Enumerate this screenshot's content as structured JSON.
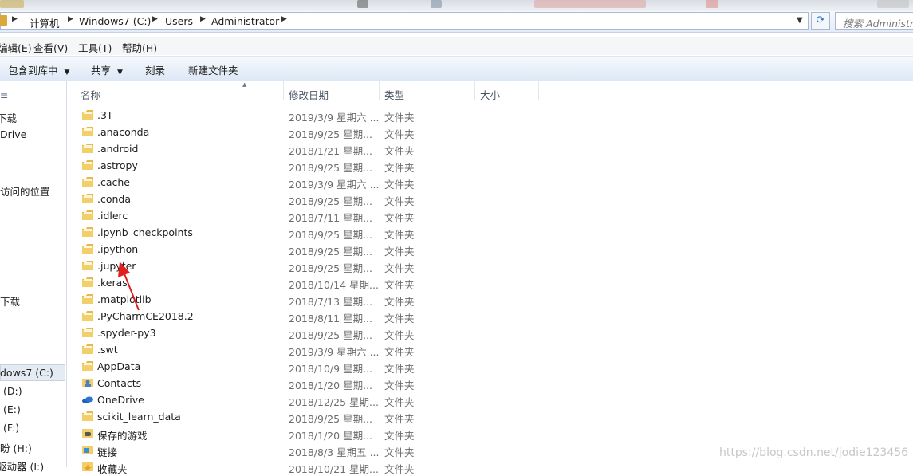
{
  "address": {
    "crumbs": [
      "计算机",
      "Windows7 (C:)",
      "Users",
      "Administrator"
    ],
    "search_placeholder": "搜索 Administrat"
  },
  "menu": [
    "编辑(E)",
    "查看(V)",
    "工具(T)",
    "帮助(H)"
  ],
  "toolbar": [
    "包含到库中",
    "共享",
    "刻录",
    "新建文件夹"
  ],
  "sidebar": [
    "下载",
    "Drive",
    "访问的位置",
    "下载",
    "dows7 (C:)",
    "(D:)",
    "(E:)",
    "(F:)",
    "盼 (H:)",
    "驱动器 (I:)"
  ],
  "columns": {
    "name": "名称",
    "date": "修改日期",
    "type": "类型",
    "size": "大小"
  },
  "files": [
    {
      "name": ".3T",
      "date": "2019/3/9 星期六 ...",
      "type": "文件夹",
      "icon": "folder-icon"
    },
    {
      "name": ".anaconda",
      "date": "2018/9/25 星期...",
      "type": "文件夹",
      "icon": "folder-icon"
    },
    {
      "name": ".android",
      "date": "2018/1/21 星期...",
      "type": "文件夹",
      "icon": "folder-icon"
    },
    {
      "name": ".astropy",
      "date": "2018/9/25 星期...",
      "type": "文件夹",
      "icon": "folder-icon"
    },
    {
      "name": ".cache",
      "date": "2019/3/9 星期六 ...",
      "type": "文件夹",
      "icon": "folder-icon"
    },
    {
      "name": ".conda",
      "date": "2018/9/25 星期...",
      "type": "文件夹",
      "icon": "folder-icon"
    },
    {
      "name": ".idlerc",
      "date": "2018/7/11 星期...",
      "type": "文件夹",
      "icon": "folder-icon"
    },
    {
      "name": ".ipynb_checkpoints",
      "date": "2018/9/25 星期...",
      "type": "文件夹",
      "icon": "folder-icon"
    },
    {
      "name": ".ipython",
      "date": "2018/9/25 星期...",
      "type": "文件夹",
      "icon": "folder-icon"
    },
    {
      "name": ".jupyter",
      "date": "2018/9/25 星期...",
      "type": "文件夹",
      "icon": "folder-icon"
    },
    {
      "name": ".keras",
      "date": "2018/10/14 星期...",
      "type": "文件夹",
      "icon": "folder-icon"
    },
    {
      "name": ".matplotlib",
      "date": "2018/7/13 星期...",
      "type": "文件夹",
      "icon": "folder-icon"
    },
    {
      "name": ".PyCharmCE2018.2",
      "date": "2018/8/11 星期...",
      "type": "文件夹",
      "icon": "folder-icon"
    },
    {
      "name": ".spyder-py3",
      "date": "2018/9/25 星期...",
      "type": "文件夹",
      "icon": "folder-icon"
    },
    {
      "name": ".swt",
      "date": "2019/3/9 星期六 ...",
      "type": "文件夹",
      "icon": "folder-icon"
    },
    {
      "name": "AppData",
      "date": "2018/10/9 星期...",
      "type": "文件夹",
      "icon": "folder-icon"
    },
    {
      "name": "Contacts",
      "date": "2018/1/20 星期...",
      "type": "文件夹",
      "icon": "contacts-icon"
    },
    {
      "name": "OneDrive",
      "date": "2018/12/25 星期...",
      "type": "文件夹",
      "icon": "onedrive-icon"
    },
    {
      "name": "scikit_learn_data",
      "date": "2018/9/25 星期...",
      "type": "文件夹",
      "icon": "folder-icon"
    },
    {
      "name": "保存的游戏",
      "date": "2018/1/20 星期...",
      "type": "文件夹",
      "icon": "saved-games-icon"
    },
    {
      "name": "链接",
      "date": "2018/8/3 星期五 ...",
      "type": "文件夹",
      "icon": "links-icon"
    },
    {
      "name": "收藏夹",
      "date": "2018/10/21 星期...",
      "type": "文件夹",
      "icon": "favorites-icon"
    }
  ],
  "watermark": "https://blog.csdn.net/jodie123456"
}
